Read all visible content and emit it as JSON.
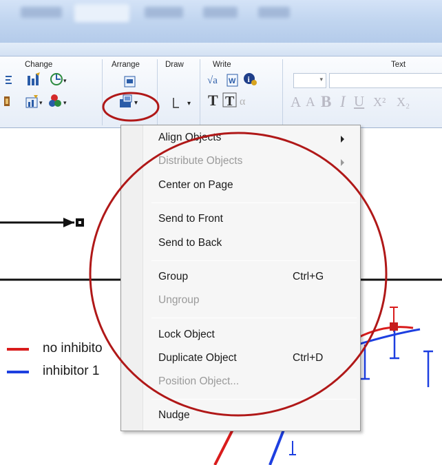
{
  "window": {
    "tabs_blurred": [
      "",
      "",
      "",
      "",
      ""
    ]
  },
  "ribbon": {
    "groups": [
      {
        "id": "change",
        "label": "Change"
      },
      {
        "id": "arrange",
        "label": "Arrange"
      },
      {
        "id": "draw",
        "label": "Draw"
      },
      {
        "id": "write",
        "label": "Write"
      },
      {
        "id": "text",
        "label": "Text"
      }
    ],
    "font_size_value": "",
    "font_name_value": "",
    "format_buttons": [
      "A",
      "A",
      "B",
      "I",
      "U",
      "X²",
      "X₂"
    ]
  },
  "graph": {
    "legend": [
      {
        "label": "no inhibito",
        "color": "#d91c1c"
      },
      {
        "label": "inhibitor 1",
        "color": "#1d3fe0"
      }
    ]
  },
  "context_menu": {
    "items": [
      {
        "label": "Align Objects",
        "enabled": true,
        "submenu": true,
        "shortcut": ""
      },
      {
        "label": "Distribute Objects",
        "enabled": false,
        "submenu": true,
        "shortcut": ""
      },
      {
        "label": "Center on Page",
        "enabled": true,
        "submenu": false,
        "shortcut": ""
      },
      {
        "label": "Send to Front",
        "enabled": true,
        "submenu": false,
        "shortcut": ""
      },
      {
        "label": "Send to Back",
        "enabled": true,
        "submenu": false,
        "shortcut": ""
      },
      {
        "label": "Group",
        "enabled": true,
        "submenu": false,
        "shortcut": "Ctrl+G"
      },
      {
        "label": "Ungroup",
        "enabled": false,
        "submenu": false,
        "shortcut": ""
      },
      {
        "label": "Lock Object",
        "enabled": true,
        "submenu": false,
        "shortcut": ""
      },
      {
        "label": "Duplicate Object",
        "enabled": true,
        "submenu": false,
        "shortcut": "Ctrl+D"
      },
      {
        "label": "Position Object...",
        "enabled": false,
        "submenu": false,
        "shortcut": ""
      },
      {
        "label": "Nudge",
        "enabled": true,
        "submenu": false,
        "shortcut": ""
      }
    ]
  },
  "colors": {
    "annotation_red": "#b01818",
    "menu_bg": "#f6f6f6",
    "disabled_text": "#9a9a9a"
  }
}
